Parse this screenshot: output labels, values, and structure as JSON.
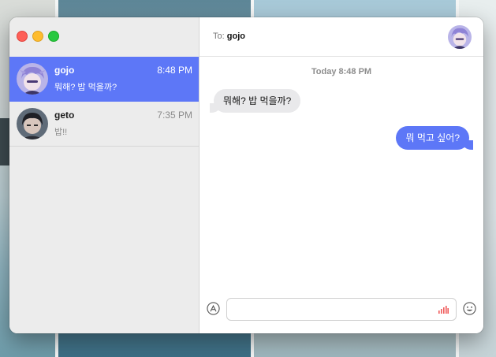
{
  "window": {
    "controls": [
      "close",
      "minimize",
      "maximize"
    ]
  },
  "sidebar": {
    "conversations": [
      {
        "name": "gojo",
        "time": "8:48 PM",
        "preview": "뭐해? 밥 먹을까?",
        "active": true,
        "avatar_icon": "avatar-purple-hair"
      },
      {
        "name": "geto",
        "time": "7:35 PM",
        "preview": "밥!!",
        "active": false,
        "avatar_icon": "avatar-dark-hair"
      }
    ]
  },
  "header": {
    "to_label": "To:",
    "recipient": "gojo",
    "avatar_icon": "avatar-purple-hair"
  },
  "thread": {
    "date_separator": "Today 8:48 PM",
    "messages": [
      {
        "direction": "incoming",
        "text": "뭐해? 밥 먹을까?"
      },
      {
        "direction": "outgoing",
        "text": "뭐 먹고 싶어?"
      }
    ]
  },
  "composer": {
    "value": "",
    "placeholder": "",
    "left_icon": "app-store-icon",
    "inline_icon": "audio-waveform-icon",
    "right_icon": "emoji-icon"
  },
  "colors": {
    "accent": "#5d77f7",
    "incoming_bubble": "#e9e9eb",
    "sidebar": "#ececec",
    "audio_icon": "#f05a5a"
  }
}
